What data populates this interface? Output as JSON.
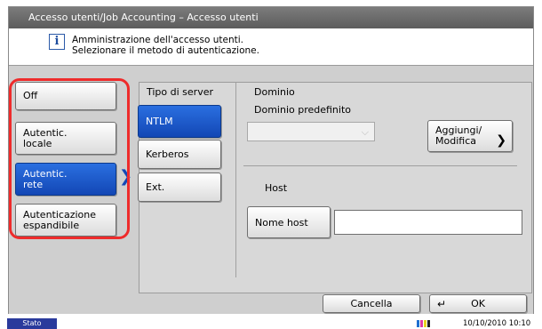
{
  "window": {
    "title": "Accesso utenti/Job Accounting – Accesso utenti"
  },
  "info": {
    "icon": "info-icon",
    "line1": "Amministrazione dell'accesso utenti.",
    "line2": "Selezionare il metodo di autenticazione."
  },
  "auth_methods": [
    {
      "line1": "Off",
      "line2": "",
      "selected": false
    },
    {
      "line1": "Autentic.",
      "line2": "locale",
      "selected": false
    },
    {
      "line1": "Autentic.",
      "line2": "rete",
      "selected": true
    },
    {
      "line1": "Autenticazione",
      "line2": "espandibile",
      "selected": false
    }
  ],
  "server": {
    "label": "Tipo di server",
    "options": [
      "NTLM",
      "Kerberos",
      "Ext."
    ],
    "selected": "NTLM"
  },
  "domain": {
    "label": "Dominio",
    "default_label": "Dominio predefinito",
    "value": "",
    "add_button_line1": "Aggiungi/",
    "add_button_line2": "Modifica"
  },
  "host": {
    "label": "Host",
    "name_button": "Nome host",
    "value": ""
  },
  "footer": {
    "cancel": "Cancella",
    "ok": "OK"
  },
  "status": {
    "stato": "Stato",
    "datetime": "10/10/2010  10:10",
    "toner_colors": [
      "#1f6fd0",
      "#e03da6",
      "#e8d21e",
      "#222222"
    ]
  },
  "colors": {
    "selected": "#1e5bd0",
    "highlight_outline": "#ee2b2b"
  }
}
